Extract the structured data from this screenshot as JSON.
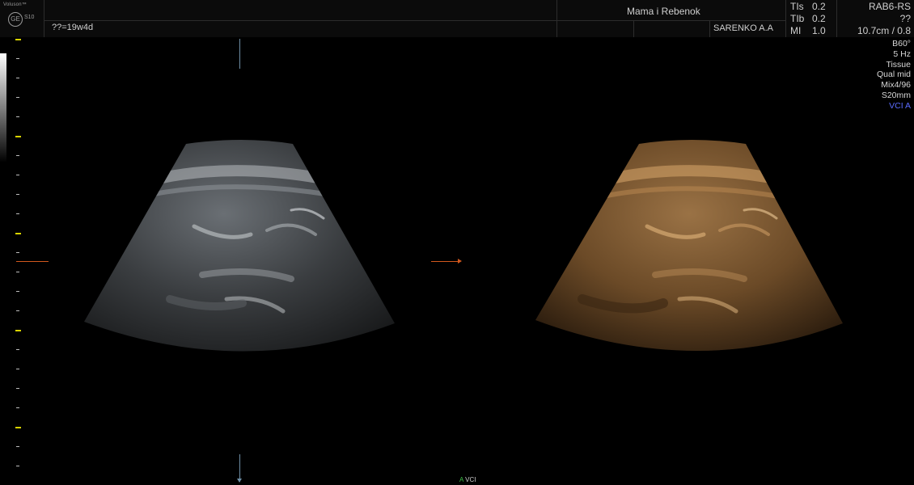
{
  "header": {
    "brand": "Voluson™",
    "model": "S10",
    "logo_icon": "ge-logo-icon",
    "gestational_age": "??=19w4d",
    "institution": "Mama i Rebenok",
    "operator": "SARENKO A.A",
    "thermal": {
      "tis_label": "TIs",
      "tis_value": "0.2",
      "tib_label": "TIb",
      "tib_value": "0.2",
      "mi_label": "MI",
      "mi_value": "1.0"
    },
    "probe": "RAB6-RS",
    "preset": "??",
    "depth_info": "10.7cm / 0.8"
  },
  "params": {
    "angle": "B60°",
    "frequency": "5 Hz",
    "tissue": "Tissue",
    "quality": "Qual mid",
    "mix": "Mix4/96",
    "slice": "S20mm",
    "vci": "VCI A"
  },
  "footer": {
    "a_label": "A",
    "vci_label": "VCI"
  },
  "colors": {
    "background": "#000000",
    "header_bg": "#0b0b0b",
    "tick_major": "#d8d300",
    "marker_orange": "#d2581d",
    "vci_accent": "#5b6cff",
    "footer_green": "#3fbf4a"
  }
}
